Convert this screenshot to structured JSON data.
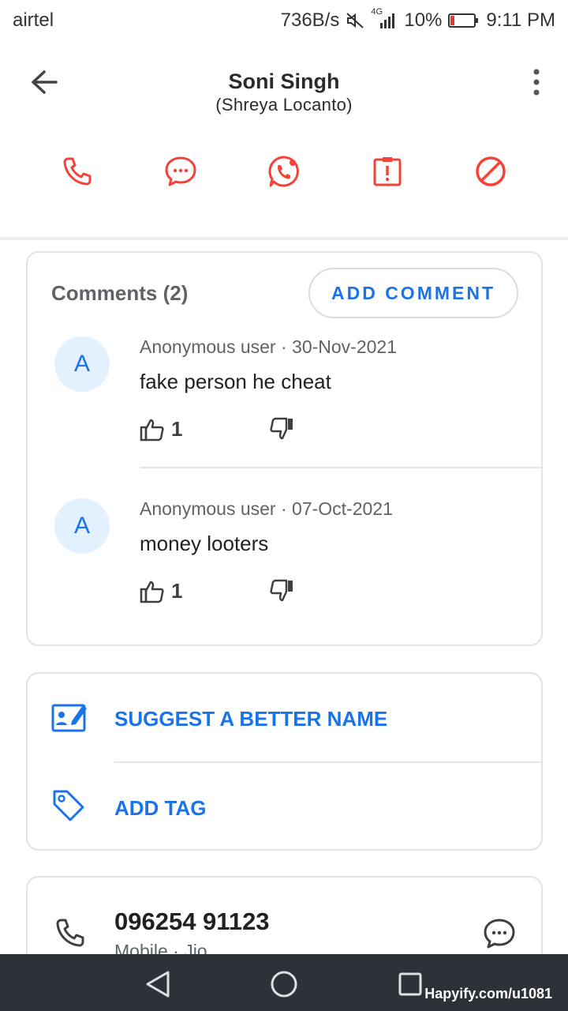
{
  "status_bar": {
    "carrier": "airtel",
    "speed": "736B/s",
    "network": "4G",
    "battery": "10%",
    "time": "9:11 PM"
  },
  "header": {
    "name": "Soni Singh",
    "subtitle": "(Shreya Locanto)",
    "actions": [
      "phone-icon",
      "message-icon",
      "whatsapp-icon",
      "report-icon",
      "block-icon"
    ],
    "accent_color": "#f44336"
  },
  "comments": {
    "title": "Comments (2)",
    "add_label": "ADD COMMENT",
    "items": [
      {
        "avatar": "A",
        "meta": "Anonymous user · 30-Nov-2021",
        "text": "fake person he cheat",
        "likes": "1"
      },
      {
        "avatar": "A",
        "meta": "Anonymous user · 07-Oct-2021",
        "text": "money looters",
        "likes": "1"
      }
    ]
  },
  "suggest": {
    "suggest_label": "SUGGEST A BETTER NAME",
    "tag_label": "ADD TAG"
  },
  "phone": {
    "number": "096254 91123",
    "sub": "Mobile · Jio"
  },
  "navbar": {
    "watermark": "Hapyify.com/u1081"
  },
  "colors": {
    "link_blue": "#1a73e8",
    "action_red": "#f44336"
  }
}
